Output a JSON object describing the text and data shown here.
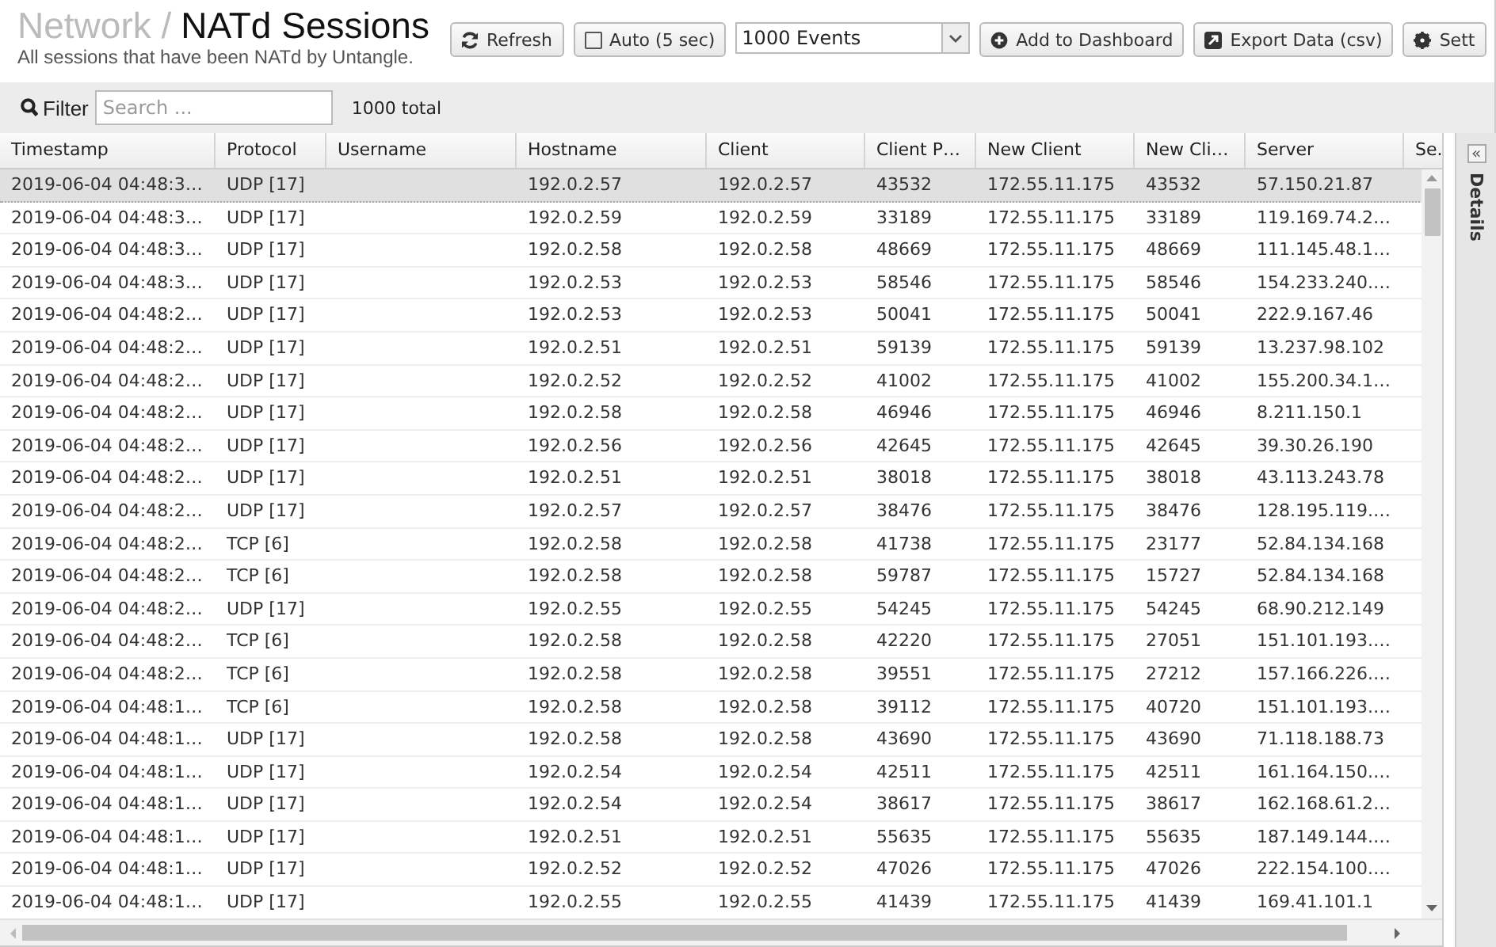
{
  "header": {
    "breadcrumb": "Network /",
    "title": "NATd Sessions",
    "subtitle": "All sessions that have been NATd by Untangle."
  },
  "toolbar": {
    "refresh": "Refresh",
    "auto": {
      "label": "Auto (5 sec)",
      "checked": false
    },
    "events": "1000 Events",
    "add": "Add to Dashboard",
    "export": "Export Data (csv)",
    "settings": "Sett"
  },
  "filter": {
    "label": "Filter",
    "placeholder": "Search ...",
    "total": "1000 total"
  },
  "table": {
    "columns": [
      "Timestamp",
      "Protocol",
      "Username",
      "Hostname",
      "Client",
      "Client P…",
      "New Client",
      "New Cli…",
      "Server",
      "Se."
    ],
    "rows": [
      {
        "selected": true,
        "timestamp": "2019-06-04 04:48:3…",
        "protocol": "UDP [17]",
        "hostname": "192.0.2.57",
        "client": "192.0.2.57",
        "client_port": "43532",
        "new_client": "172.55.11.175",
        "new_client_port": "43532",
        "server": "57.150.21.87"
      },
      {
        "selected": false,
        "timestamp": "2019-06-04 04:48:3…",
        "protocol": "UDP [17]",
        "hostname": "192.0.2.59",
        "client": "192.0.2.59",
        "client_port": "33189",
        "new_client": "172.55.11.175",
        "new_client_port": "33189",
        "server": "119.169.74.2…"
      },
      {
        "selected": false,
        "timestamp": "2019-06-04 04:48:3…",
        "protocol": "UDP [17]",
        "hostname": "192.0.2.58",
        "client": "192.0.2.58",
        "client_port": "48669",
        "new_client": "172.55.11.175",
        "new_client_port": "48669",
        "server": "111.145.48.1…"
      },
      {
        "selected": false,
        "timestamp": "2019-06-04 04:48:3…",
        "protocol": "UDP [17]",
        "hostname": "192.0.2.53",
        "client": "192.0.2.53",
        "client_port": "58546",
        "new_client": "172.55.11.175",
        "new_client_port": "58546",
        "server": "154.233.240.…"
      },
      {
        "selected": false,
        "timestamp": "2019-06-04 04:48:2…",
        "protocol": "UDP [17]",
        "hostname": "192.0.2.53",
        "client": "192.0.2.53",
        "client_port": "50041",
        "new_client": "172.55.11.175",
        "new_client_port": "50041",
        "server": "222.9.167.46"
      },
      {
        "selected": false,
        "timestamp": "2019-06-04 04:48:2…",
        "protocol": "UDP [17]",
        "hostname": "192.0.2.51",
        "client": "192.0.2.51",
        "client_port": "59139",
        "new_client": "172.55.11.175",
        "new_client_port": "59139",
        "server": "13.237.98.102"
      },
      {
        "selected": false,
        "timestamp": "2019-06-04 04:48:2…",
        "protocol": "UDP [17]",
        "hostname": "192.0.2.52",
        "client": "192.0.2.52",
        "client_port": "41002",
        "new_client": "172.55.11.175",
        "new_client_port": "41002",
        "server": "155.200.34.1…"
      },
      {
        "selected": false,
        "timestamp": "2019-06-04 04:48:2…",
        "protocol": "UDP [17]",
        "hostname": "192.0.2.58",
        "client": "192.0.2.58",
        "client_port": "46946",
        "new_client": "172.55.11.175",
        "new_client_port": "46946",
        "server": "8.211.150.1"
      },
      {
        "selected": false,
        "timestamp": "2019-06-04 04:48:2…",
        "protocol": "UDP [17]",
        "hostname": "192.0.2.56",
        "client": "192.0.2.56",
        "client_port": "42645",
        "new_client": "172.55.11.175",
        "new_client_port": "42645",
        "server": "39.30.26.190"
      },
      {
        "selected": false,
        "timestamp": "2019-06-04 04:48:2…",
        "protocol": "UDP [17]",
        "hostname": "192.0.2.51",
        "client": "192.0.2.51",
        "client_port": "38018",
        "new_client": "172.55.11.175",
        "new_client_port": "38018",
        "server": "43.113.243.78"
      },
      {
        "selected": false,
        "timestamp": "2019-06-04 04:48:2…",
        "protocol": "UDP [17]",
        "hostname": "192.0.2.57",
        "client": "192.0.2.57",
        "client_port": "38476",
        "new_client": "172.55.11.175",
        "new_client_port": "38476",
        "server": "128.195.119.…"
      },
      {
        "selected": false,
        "timestamp": "2019-06-04 04:48:2…",
        "protocol": "TCP [6]",
        "hostname": "192.0.2.58",
        "client": "192.0.2.58",
        "client_port": "41738",
        "new_client": "172.55.11.175",
        "new_client_port": "23177",
        "server": "52.84.134.168"
      },
      {
        "selected": false,
        "timestamp": "2019-06-04 04:48:2…",
        "protocol": "TCP [6]",
        "hostname": "192.0.2.58",
        "client": "192.0.2.58",
        "client_port": "59787",
        "new_client": "172.55.11.175",
        "new_client_port": "15727",
        "server": "52.84.134.168"
      },
      {
        "selected": false,
        "timestamp": "2019-06-04 04:48:2…",
        "protocol": "UDP [17]",
        "hostname": "192.0.2.55",
        "client": "192.0.2.55",
        "client_port": "54245",
        "new_client": "172.55.11.175",
        "new_client_port": "54245",
        "server": "68.90.212.149"
      },
      {
        "selected": false,
        "timestamp": "2019-06-04 04:48:2…",
        "protocol": "TCP [6]",
        "hostname": "192.0.2.58",
        "client": "192.0.2.58",
        "client_port": "42220",
        "new_client": "172.55.11.175",
        "new_client_port": "27051",
        "server": "151.101.193.…"
      },
      {
        "selected": false,
        "timestamp": "2019-06-04 04:48:2…",
        "protocol": "TCP [6]",
        "hostname": "192.0.2.58",
        "client": "192.0.2.58",
        "client_port": "39551",
        "new_client": "172.55.11.175",
        "new_client_port": "27212",
        "server": "157.166.226.…"
      },
      {
        "selected": false,
        "timestamp": "2019-06-04 04:48:1…",
        "protocol": "TCP [6]",
        "hostname": "192.0.2.58",
        "client": "192.0.2.58",
        "client_port": "39112",
        "new_client": "172.55.11.175",
        "new_client_port": "40720",
        "server": "151.101.193.…"
      },
      {
        "selected": false,
        "timestamp": "2019-06-04 04:48:1…",
        "protocol": "UDP [17]",
        "hostname": "192.0.2.58",
        "client": "192.0.2.58",
        "client_port": "43690",
        "new_client": "172.55.11.175",
        "new_client_port": "43690",
        "server": "71.118.188.73"
      },
      {
        "selected": false,
        "timestamp": "2019-06-04 04:48:1…",
        "protocol": "UDP [17]",
        "hostname": "192.0.2.54",
        "client": "192.0.2.54",
        "client_port": "42511",
        "new_client": "172.55.11.175",
        "new_client_port": "42511",
        "server": "161.164.150.…"
      },
      {
        "selected": false,
        "timestamp": "2019-06-04 04:48:1…",
        "protocol": "UDP [17]",
        "hostname": "192.0.2.54",
        "client": "192.0.2.54",
        "client_port": "38617",
        "new_client": "172.55.11.175",
        "new_client_port": "38617",
        "server": "162.168.61.2…"
      },
      {
        "selected": false,
        "timestamp": "2019-06-04 04:48:1…",
        "protocol": "UDP [17]",
        "hostname": "192.0.2.51",
        "client": "192.0.2.51",
        "client_port": "55635",
        "new_client": "172.55.11.175",
        "new_client_port": "55635",
        "server": "187.149.144.…"
      },
      {
        "selected": false,
        "timestamp": "2019-06-04 04:48:1…",
        "protocol": "UDP [17]",
        "hostname": "192.0.2.52",
        "client": "192.0.2.52",
        "client_port": "47026",
        "new_client": "172.55.11.175",
        "new_client_port": "47026",
        "server": "222.154.100.…"
      },
      {
        "selected": false,
        "timestamp": "2019-06-04 04:48:1…",
        "protocol": "UDP [17]",
        "hostname": "192.0.2.55",
        "client": "192.0.2.55",
        "client_port": "41439",
        "new_client": "172.55.11.175",
        "new_client_port": "41439",
        "server": "169.41.101.1"
      }
    ]
  },
  "details": {
    "label": "Details",
    "expand": "«"
  }
}
